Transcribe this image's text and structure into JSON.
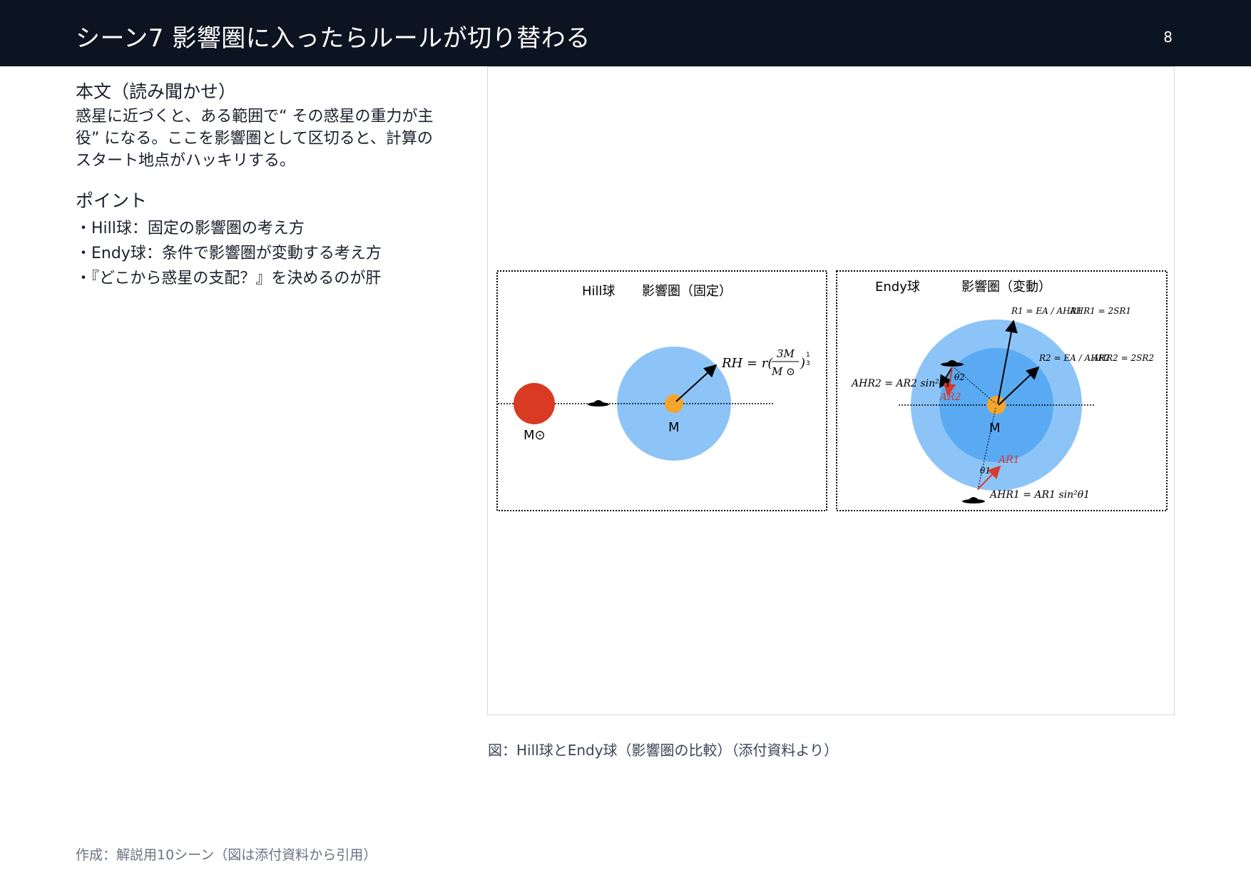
{
  "header": {
    "title": "シーン7  影響圏に入ったらルールが切り替わる",
    "page_number": "8"
  },
  "left": {
    "body_heading": "本文（読み聞かせ）",
    "body_text": "惑星に近づくと、ある範囲で“ その惑星の重力が主役” になる。ここを影響圏として区切ると、計算のスタート地点がハッキリする。",
    "points_heading": "ポイント",
    "points": [
      "・Hill球：固定の影響圏の考え方",
      "・Endy球：条件で影響圏が変動する考え方",
      "・『どこから惑星の支配？』を決めるのが肝"
    ]
  },
  "figure": {
    "hill": {
      "title": "Hill球",
      "subtitle": "影響圏（固定）",
      "sun_label": "M⊙",
      "planet_label": "M",
      "formula": "RH = r(3M / M⊙)^(1/3)"
    },
    "endy": {
      "title": "Endy球",
      "subtitle": "影響圏（変動）",
      "planet_label": "M",
      "r1_formula": "R1 = EA / AHR1",
      "a_hr1_eq": "AHR1 = 2SR1",
      "r2_formula": "R2 = EA / AHR2",
      "a_hr2_eq": "AHR2 = 2SR2",
      "a_hr2_formula": "AHR2 = AR2 sin²θ1",
      "a_hr1_formula": "AHR1 = AR1 sin²θ1",
      "a_r1_label": "AR1",
      "a_r2_label": "AR2",
      "theta1_label": "θ1",
      "theta2_label": "θ2"
    },
    "colors": {
      "sun": "#d93a23",
      "planet": "#f4a52a",
      "sphere_outer": "#8dc4f7",
      "sphere_inner": "#5aaaf3",
      "red_vector": "#d63a2e"
    }
  },
  "caption": "図：Hill球とEndy球（影響圏の比較）（添付資料より）",
  "footer": "作成：解説用10シーン（図は添付資料から引用）"
}
